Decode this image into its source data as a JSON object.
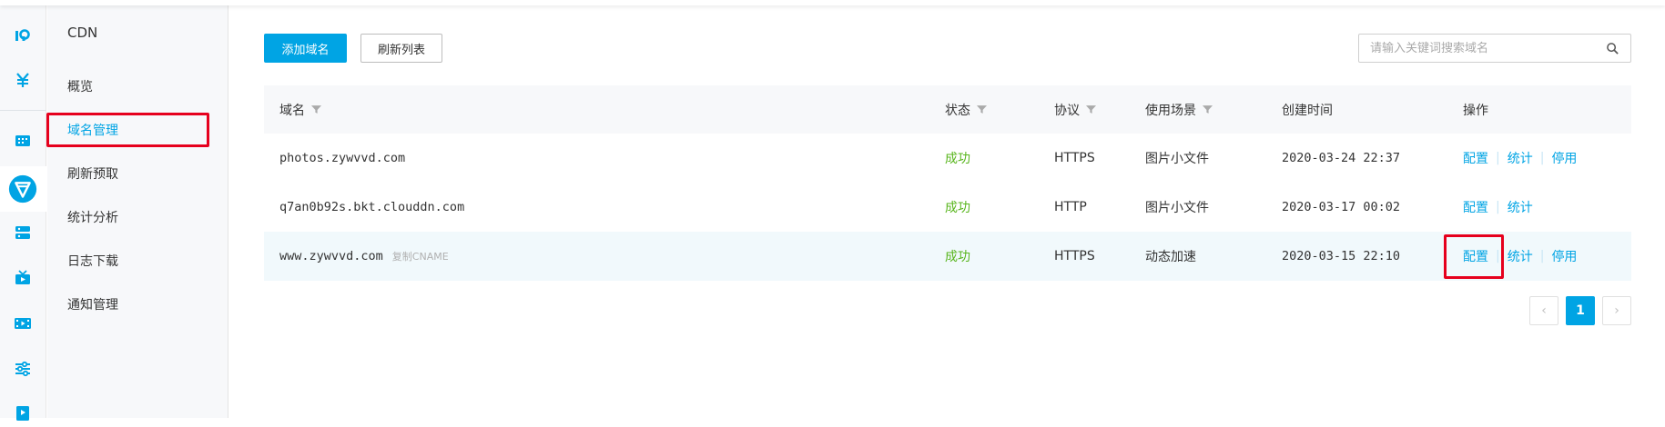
{
  "colors": {
    "accent": "#00a4e4",
    "success": "#58b51d",
    "highlight": "#e6001d"
  },
  "rail": {
    "icons": [
      "brand-logo-icon",
      "yen-icon",
      "dashboard-icon",
      "cdn-icon",
      "storage-icon",
      "media-icon",
      "video-icon",
      "settings-sliders-icon",
      "player-icon"
    ]
  },
  "subnav": {
    "title": "CDN",
    "items": [
      {
        "label": "概览"
      },
      {
        "label": "域名管理"
      },
      {
        "label": "刷新预取"
      },
      {
        "label": "统计分析"
      },
      {
        "label": "日志下载"
      },
      {
        "label": "通知管理"
      }
    ]
  },
  "toolbar": {
    "add_label": "添加域名",
    "refresh_label": "刷新列表"
  },
  "search": {
    "placeholder": "请输入关键词搜索域名"
  },
  "table": {
    "headers": {
      "domain": "域名",
      "status": "状态",
      "protocol": "协议",
      "scenario": "使用场景",
      "created": "创建时间",
      "actions": "操作"
    },
    "rows": [
      {
        "domain": "photos.zywvvd.com",
        "status": "成功",
        "protocol": "HTTPS",
        "scenario": "图片小文件",
        "created": "2020-03-24 22:37",
        "config": "配置",
        "stats": "统计",
        "disable": "停用"
      },
      {
        "domain": "q7an0b92s.bkt.clouddn.com",
        "status": "成功",
        "protocol": "HTTP",
        "scenario": "图片小文件",
        "created": "2020-03-17 00:02",
        "config": "配置",
        "stats": "统计"
      },
      {
        "domain": "www.zywvvd.com",
        "cname": "复制CNAME",
        "status": "成功",
        "protocol": "HTTPS",
        "scenario": "动态加速",
        "created": "2020-03-15 22:10",
        "config": "配置",
        "stats": "统计",
        "disable": "停用"
      }
    ]
  },
  "pagination": {
    "prev": "‹",
    "current": "1",
    "next": "›"
  }
}
